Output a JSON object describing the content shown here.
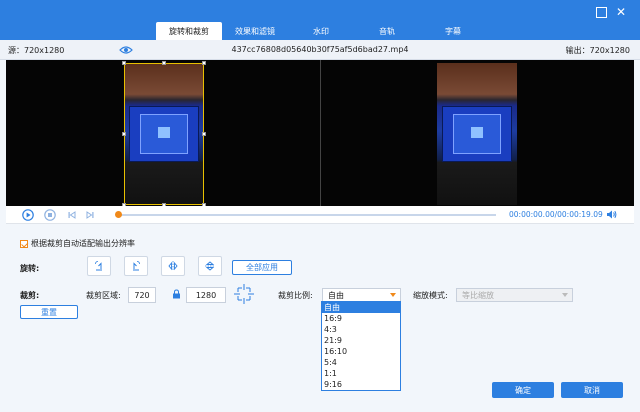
{
  "tabs": [
    "旋转和裁剪",
    "效果和滤镜",
    "水印",
    "音轨",
    "字幕"
  ],
  "info": {
    "source": "源：720x1280",
    "filename": "437cc76808d05640b30f75af5d6bad27.mp4",
    "output": "输出：720x1280"
  },
  "player": {
    "time": "00:00:00.00/00:00:19.09"
  },
  "auto_fit": "根据裁剪自动适配输出分辨率",
  "rotate": {
    "label": "旋转:",
    "apply_all": "全部应用"
  },
  "crop": {
    "label": "裁剪:",
    "area_label": "裁剪区域:",
    "width": "720",
    "height": "1280",
    "ratio_label": "裁剪比例:",
    "ratio_value": "自由",
    "zoom_label": "缩放模式:",
    "zoom_value": "等比缩放",
    "reset": "重置",
    "ratio_options": [
      "自由",
      "16:9",
      "4:3",
      "21:9",
      "16:10",
      "5:4",
      "1:1",
      "9:16"
    ]
  },
  "footer": {
    "ok": "确定",
    "cancel": "取消"
  },
  "colors": {
    "accent": "#2d7fe0",
    "orange": "#f0891a"
  }
}
